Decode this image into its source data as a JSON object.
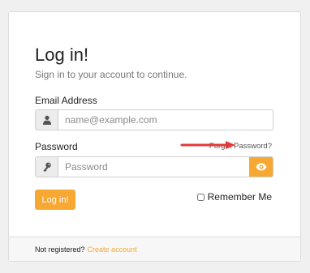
{
  "login": {
    "title": "Log in!",
    "subtitle": "Sign in to your account to continue.",
    "email_label": "Email Address",
    "email_placeholder": "name@example.com",
    "password_label": "Password",
    "password_placeholder": "Password",
    "forgot_link": "Forgot Password?",
    "submit_label": "Log in!",
    "remember_label": "Remember Me"
  },
  "footer": {
    "text": "Not registered?",
    "link": "Create account"
  },
  "icons": {
    "email": "user-icon",
    "password": "key-icon",
    "toggle": "eye-icon",
    "annotation": "red-arrow-icon"
  },
  "colors": {
    "accent": "#f7a833",
    "arrow": "#e03a3a"
  }
}
